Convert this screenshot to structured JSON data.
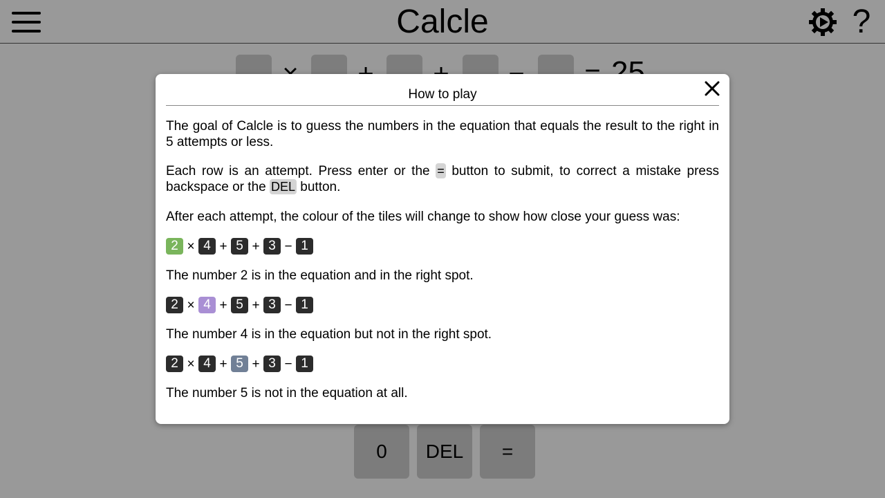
{
  "app": {
    "title": "Calcle"
  },
  "header": {
    "menu_icon": "hamburger-icon",
    "settings_icon": "gear-icon",
    "help_label": "?"
  },
  "board": {
    "operators": [
      "×",
      "+",
      "+",
      "−",
      "="
    ],
    "result": "25"
  },
  "keypad": {
    "keys": [
      "0",
      "DEL",
      "="
    ]
  },
  "modal": {
    "title": "How to play",
    "close_icon": "close-icon",
    "para1": "The goal of Calcle is to guess the numbers in the equation that equals the result to the right in 5 attempts or less.",
    "para2_a": "Each row is an attempt. Press enter or the ",
    "para2_eq": "=",
    "para2_b": " button to submit, to correct a mistake press backspace or the ",
    "para2_del": "DEL",
    "para2_c": " button.",
    "para3": "After each attempt, the colour of the tiles will change to show how close your guess was:",
    "examples": [
      {
        "tiles": [
          "2",
          "4",
          "5",
          "3",
          "1"
        ],
        "ops": [
          "×",
          "+",
          "+",
          "−"
        ],
        "highlight_index": 0,
        "highlight_color": "#7ab55c",
        "caption": "The number 2 is in the equation and in the right spot."
      },
      {
        "tiles": [
          "2",
          "4",
          "5",
          "3",
          "1"
        ],
        "ops": [
          "×",
          "+",
          "+",
          "−"
        ],
        "highlight_index": 1,
        "highlight_color": "#a98fd4",
        "caption": "The number 4 is in the equation but not in the right spot."
      },
      {
        "tiles": [
          "2",
          "4",
          "5",
          "3",
          "1"
        ],
        "ops": [
          "×",
          "+",
          "+",
          "−"
        ],
        "highlight_index": 2,
        "highlight_color": "#718096",
        "caption": "The number 5 is not in the equation at all."
      }
    ]
  },
  "colors": {
    "correct": "#7ab55c",
    "present": "#a98fd4",
    "absent": "#718096",
    "tile_default": "#2c2c2c"
  }
}
